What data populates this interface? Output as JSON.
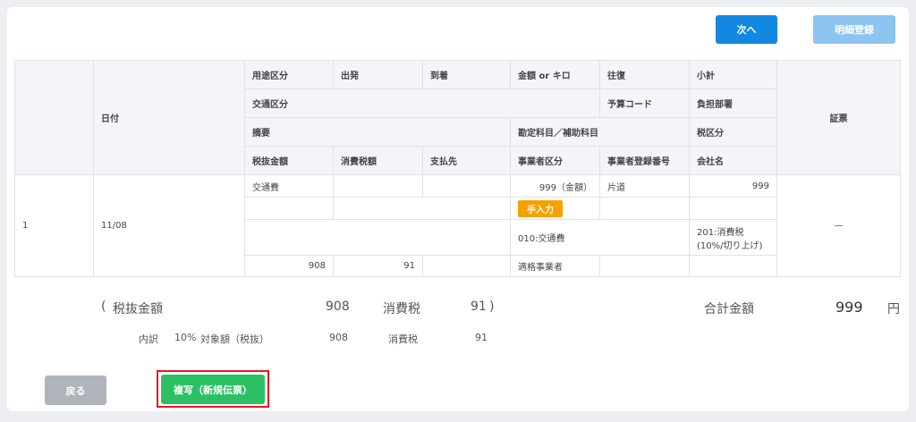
{
  "toolbar": {
    "next_label": "次へ",
    "register_label": "明細登録"
  },
  "table": {
    "headers": {
      "date": "日付",
      "purpose": "用途区分",
      "departure": "出発",
      "arrival": "到着",
      "amount_or_km": "金額 or キロ",
      "round_trip": "往復",
      "subtotal": "小計",
      "transport": "交通区分",
      "budget_code": "予算コード",
      "department": "負担部署",
      "summary": "摘要",
      "account": "勘定科目／補助科目",
      "tax_category": "税区分",
      "pretax": "税抜金額",
      "consumption_tax": "消費税額",
      "payee": "支払先",
      "biz_category": "事業者区分",
      "biz_reg_no": "事業者登録番号",
      "company": "会社名",
      "receipt": "証票"
    },
    "row": {
      "no": "1",
      "date": "11/08",
      "purpose": "交通費",
      "amount": "999（金額）",
      "round_trip": "片道",
      "subtotal": "999",
      "badge": "手入力",
      "account": "010:交通費",
      "tax_category": "201:消費税(10%/切り上げ)",
      "pretax": "908",
      "tax": "91",
      "biz_category": "適格事業者",
      "receipt": "—"
    }
  },
  "summary": {
    "open_paren": "(",
    "pretax_label": "税抜金額",
    "pretax_value": "908",
    "tax_label": "消費税",
    "tax_value": "91",
    "close_paren": ")",
    "total_label": "合計金額",
    "total_value": "999",
    "currency": "円",
    "breakdown_label": "内訳",
    "breakdown_rate": "10%",
    "breakdown_target_label": "対象額（税抜）",
    "breakdown_target_value": "908",
    "breakdown_tax_label": "消費税",
    "breakdown_tax_value": "91"
  },
  "footer": {
    "back_label": "戻る",
    "copy_label": "複写（新規伝票）"
  }
}
